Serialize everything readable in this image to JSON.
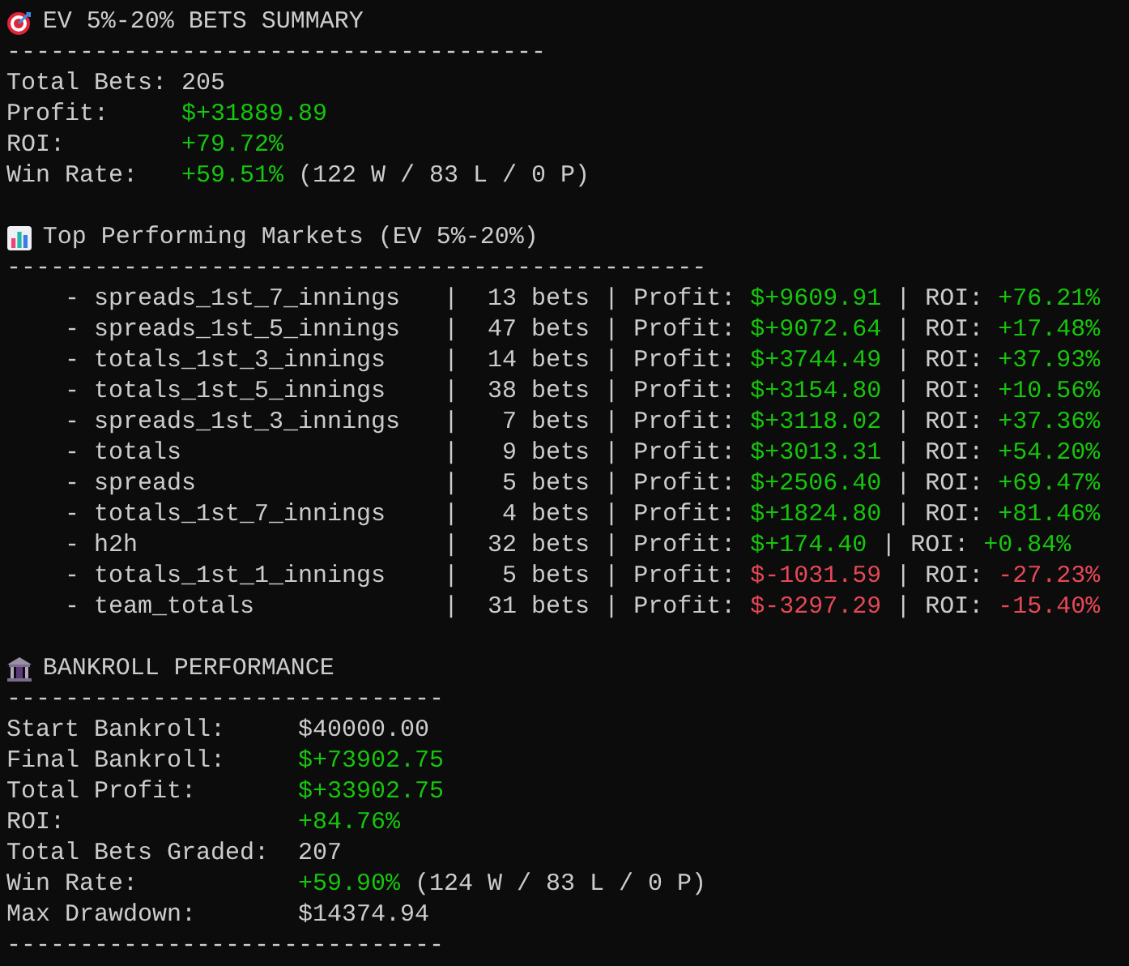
{
  "summary": {
    "title": "EV 5%-20% BETS SUMMARY",
    "divider": "-------------------------------------",
    "stats": [
      {
        "label": "Total Bets:",
        "value": {
          "text": "205",
          "color": "#cccccc"
        }
      },
      {
        "label": "Profit:",
        "value": {
          "text": "$+31889.89",
          "color": "#16c60c"
        }
      },
      {
        "label": "ROI:",
        "value": {
          "text": "+79.72%",
          "color": "#16c60c"
        }
      },
      {
        "label": "Win Rate:",
        "value": {
          "text": "+59.51%",
          "color": "#16c60c"
        },
        "detail": "(122 W / 83 L / 0 P)"
      }
    ]
  },
  "markets": {
    "title": "Top Performing Markets (EV 5%-20%)",
    "divider": "------------------------------------------------",
    "rows": [
      {
        "name": "- spreads_1st_7_innings",
        "sep1": "|",
        "bets": "13 bets",
        "sep2": "|",
        "profit_label": "Profit:",
        "profit": {
          "text": "$+9609.91",
          "color": "#16c60c"
        },
        "sep3": "|",
        "roi_label": "ROI:",
        "roi": {
          "text": "+76.21%",
          "color": "#16c60c"
        }
      },
      {
        "name": "- spreads_1st_5_innings",
        "sep1": "|",
        "bets": "47 bets",
        "sep2": "|",
        "profit_label": "Profit:",
        "profit": {
          "text": "$+9072.64",
          "color": "#16c60c"
        },
        "sep3": "|",
        "roi_label": "ROI:",
        "roi": {
          "text": "+17.48%",
          "color": "#16c60c"
        }
      },
      {
        "name": "- totals_1st_3_innings",
        "sep1": "|",
        "bets": "14 bets",
        "sep2": "|",
        "profit_label": "Profit:",
        "profit": {
          "text": "$+3744.49",
          "color": "#16c60c"
        },
        "sep3": "|",
        "roi_label": "ROI:",
        "roi": {
          "text": "+37.93%",
          "color": "#16c60c"
        }
      },
      {
        "name": "- totals_1st_5_innings",
        "sep1": "|",
        "bets": "38 bets",
        "sep2": "|",
        "profit_label": "Profit:",
        "profit": {
          "text": "$+3154.80",
          "color": "#16c60c"
        },
        "sep3": "|",
        "roi_label": "ROI:",
        "roi": {
          "text": "+10.56%",
          "color": "#16c60c"
        }
      },
      {
        "name": "- spreads_1st_3_innings",
        "sep1": "|",
        "bets": "7 bets",
        "sep2": "|",
        "profit_label": "Profit:",
        "profit": {
          "text": "$+3118.02",
          "color": "#16c60c"
        },
        "sep3": "|",
        "roi_label": "ROI:",
        "roi": {
          "text": "+37.36%",
          "color": "#16c60c"
        }
      },
      {
        "name": "- totals",
        "sep1": "|",
        "bets": "9 bets",
        "sep2": "|",
        "profit_label": "Profit:",
        "profit": {
          "text": "$+3013.31",
          "color": "#16c60c"
        },
        "sep3": "|",
        "roi_label": "ROI:",
        "roi": {
          "text": "+54.20%",
          "color": "#16c60c"
        }
      },
      {
        "name": "- spreads",
        "sep1": "|",
        "bets": "5 bets",
        "sep2": "|",
        "profit_label": "Profit:",
        "profit": {
          "text": "$+2506.40",
          "color": "#16c60c"
        },
        "sep3": "|",
        "roi_label": "ROI:",
        "roi": {
          "text": "+69.47%",
          "color": "#16c60c"
        }
      },
      {
        "name": "- totals_1st_7_innings",
        "sep1": "|",
        "bets": "4 bets",
        "sep2": "|",
        "profit_label": "Profit:",
        "profit": {
          "text": "$+1824.80",
          "color": "#16c60c"
        },
        "sep3": "|",
        "roi_label": "ROI:",
        "roi": {
          "text": "+81.46%",
          "color": "#16c60c"
        }
      },
      {
        "name": "- h2h",
        "sep1": "|",
        "bets": "32 bets",
        "sep2": "|",
        "profit_label": "Profit:",
        "profit": {
          "text": "$+174.40",
          "color": "#16c60c"
        },
        "sep3": "|",
        "roi_label": "ROI:",
        "roi": {
          "text": "+0.84%",
          "color": "#16c60c"
        }
      },
      {
        "name": "- totals_1st_1_innings",
        "sep1": "|",
        "bets": "5 bets",
        "sep2": "|",
        "profit_label": "Profit:",
        "profit": {
          "text": "$-1031.59",
          "color": "#e74856"
        },
        "sep3": "|",
        "roi_label": "ROI:",
        "roi": {
          "text": "-27.23%",
          "color": "#e74856"
        }
      },
      {
        "name": "- team_totals",
        "sep1": "|",
        "bets": "31 bets",
        "sep2": "|",
        "profit_label": "Profit:",
        "profit": {
          "text": "$-3297.29",
          "color": "#e74856"
        },
        "sep3": "|",
        "roi_label": "ROI:",
        "roi": {
          "text": "-15.40%",
          "color": "#e74856"
        }
      }
    ]
  },
  "bankroll": {
    "title": "BANKROLL PERFORMANCE",
    "divider": "------------------------------",
    "stats": [
      {
        "label": "Start Bankroll:",
        "value": {
          "text": "$40000.00",
          "color": "#cccccc"
        }
      },
      {
        "label": "Final Bankroll:",
        "value": {
          "text": "$+73902.75",
          "color": "#16c60c"
        }
      },
      {
        "label": "Total Profit:",
        "value": {
          "text": "$+33902.75",
          "color": "#16c60c"
        }
      },
      {
        "label": "ROI:",
        "value": {
          "text": "+84.76%",
          "color": "#16c60c"
        }
      },
      {
        "label": "Total Bets Graded:",
        "value": {
          "text": "207",
          "color": "#cccccc"
        }
      },
      {
        "label": "Win Rate:",
        "value": {
          "text": "+59.90%",
          "color": "#16c60c"
        },
        "detail": "(124 W / 83 L / 0 P)"
      },
      {
        "label": "Max Drawdown:",
        "value": {
          "text": "$14374.94",
          "color": "#cccccc"
        }
      }
    ],
    "footer_divider": "------------------------------"
  }
}
